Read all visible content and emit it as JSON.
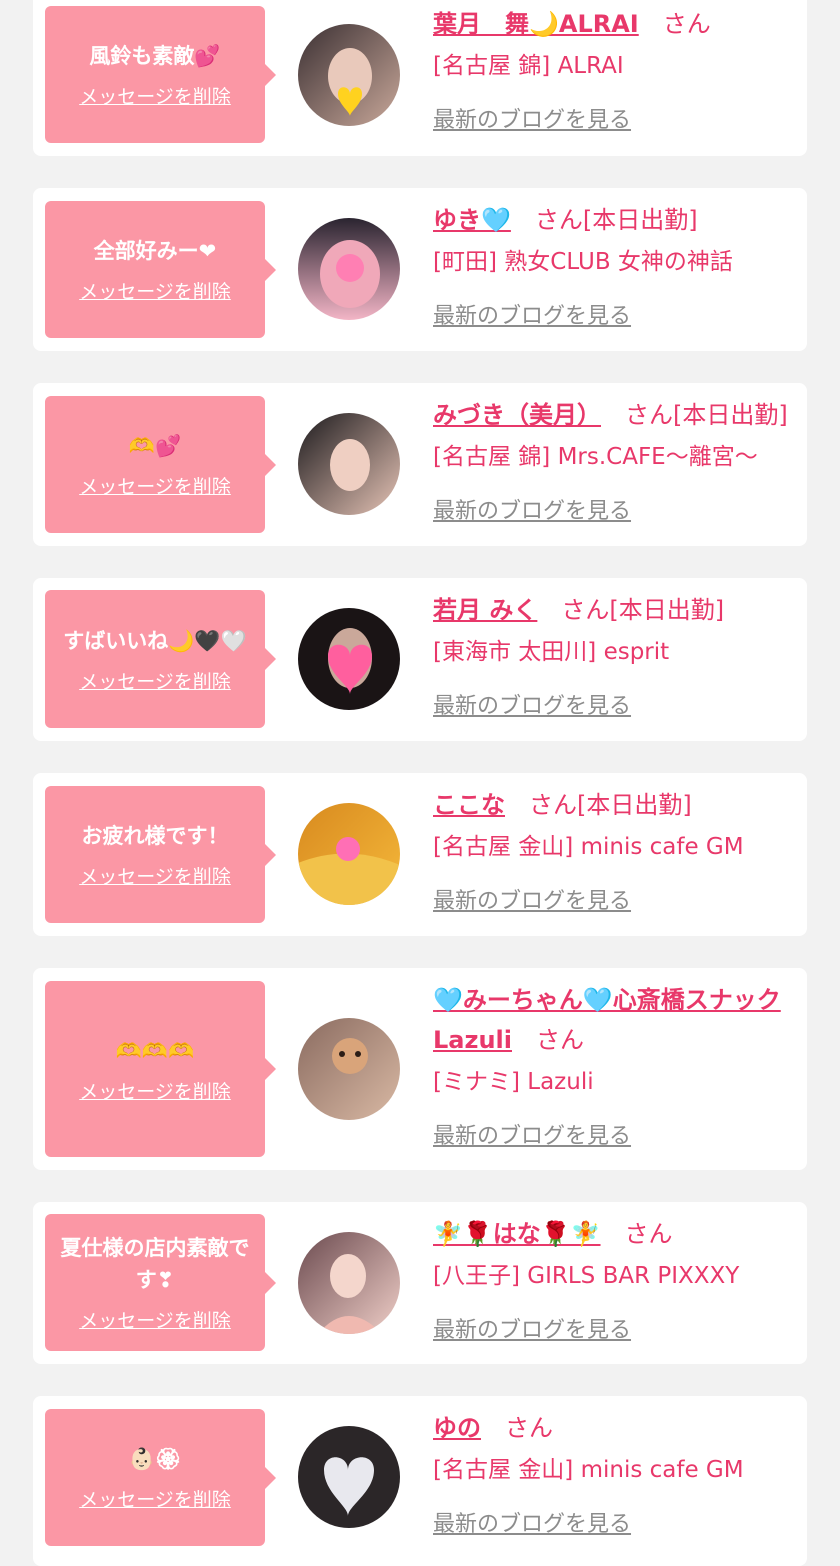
{
  "labels": {
    "delete": "メッセージを削除",
    "blog": "最新のブログを見る"
  },
  "items": [
    {
      "message": "風鈴も素敵💕",
      "name": "葉月　舞🌙ALRAI",
      "suffix": "さん",
      "shop": "[名古屋 錦] ALRAI",
      "avatar_colors": [
        "#3b3033",
        "#c9a89a"
      ]
    },
    {
      "message": "全部好みー❤",
      "name": "ゆき🩵",
      "suffix": "さん[本日出勤]",
      "shop": "[町田] 熟女CLUB 女神の神話",
      "avatar_colors": [
        "#2a2430",
        "#f3b5c6"
      ]
    },
    {
      "message": "🫶💕",
      "name": "みづき（美月）",
      "suffix": "さん[本日出勤]",
      "shop": "[名古屋 錦] Mrs.CAFE〜離宮〜",
      "avatar_colors": [
        "#1c1a1d",
        "#e7c4b6"
      ]
    },
    {
      "message": "すばいいね🌙🖤🤍",
      "name": "若月 みく",
      "suffix": "さん[本日出勤]",
      "shop": "[東海市 太田川] esprit",
      "avatar_colors": [
        "#1a1415",
        "#ff5f9e"
      ]
    },
    {
      "message": "お疲れ様です！",
      "name": "ここな",
      "suffix": "さん[本日出勤]",
      "shop": "[名古屋 金山] minis cafe GM",
      "avatar_colors": [
        "#d88a1f",
        "#f5b93b"
      ]
    },
    {
      "message": "🫶🫶🫶",
      "name": "🩵みーちゃん🩵心斎橋スナックLazuli",
      "suffix": "さん",
      "shop": "[ミナミ] Lazuli",
      "avatar_colors": [
        "#8a6b60",
        "#d9b9a4"
      ]
    },
    {
      "message": "夏仕様の店内素敵です❣",
      "name": "🧚🌹はな🌹🧚",
      "suffix": "さん",
      "shop": "[八王子] GIRLS BAR PIXXXY",
      "avatar_colors": [
        "#6b4a4f",
        "#f0cfc8"
      ]
    },
    {
      "message": "👶🏻🏵",
      "name": "ゆの",
      "suffix": "さん",
      "shop": "[名古屋 金山] minis cafe GM",
      "avatar_colors": [
        "#2b2628",
        "#e8e8ee"
      ]
    }
  ]
}
